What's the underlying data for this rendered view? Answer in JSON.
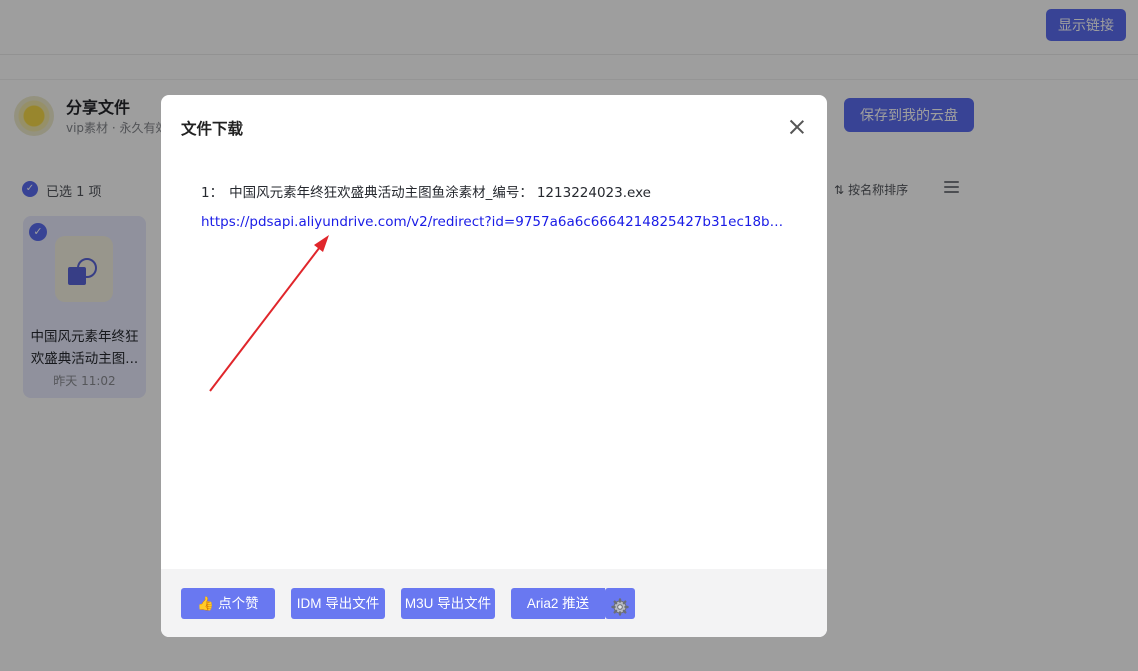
{
  "topbar": {
    "show_link_label": "显示链接"
  },
  "share": {
    "title": "分享文件",
    "subtitle": "vip素材 · 永久有效",
    "save_label": "保存到我的云盘"
  },
  "toolbar": {
    "selected_label": "已选 1 项",
    "sort_label": "按名称排序"
  },
  "file_card": {
    "name": "中国风元素年终狂欢盛典活动主图...",
    "time": "昨天 11:02"
  },
  "dialog": {
    "title": "文件下载",
    "file_index": "1：",
    "file_name": "中国风元素年终狂欢盛典活动主图鱼涂素材_编号：",
    "file_id": "1213224023.exe",
    "link": "https://pdsapi.aliyundrive.com/v2/redirect?id=9757a6a6c6664214825427b31ec18bd9...",
    "buttons": {
      "like": "点个赞",
      "like_icon": "👍",
      "idm": "IDM 导出文件",
      "m3u": "M3U 导出文件",
      "aria2": "Aria2 推送"
    }
  },
  "colors": {
    "accent": "#5b6cf0",
    "link": "#1a1ce6",
    "arrow": "#e0262b"
  }
}
